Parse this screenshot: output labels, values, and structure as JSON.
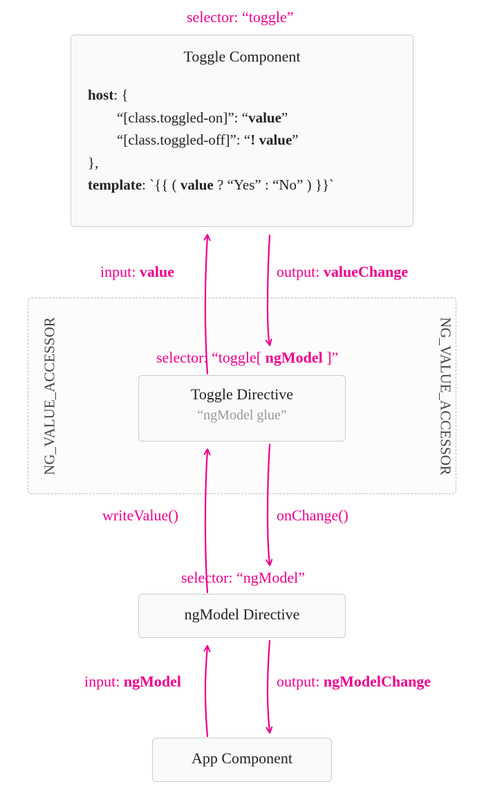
{
  "selectors": {
    "toggle": "selector: “toggle”",
    "toggleNgModel_pre": "selector: “toggle[ ",
    "toggleNgModel_bold": "ngModel",
    "toggleNgModel_post": " ]”",
    "ngModel": "selector: “ngModel”"
  },
  "boxes": {
    "toggleComponent": {
      "title": "Toggle Component",
      "hostLabel": "host",
      "hostOpen": ": {",
      "line1_pre": "“[class.toggled-on]”: “",
      "line1_bold": "value",
      "line1_post": "”",
      "line2_pre": "“[class.toggled-off]”: “",
      "line2_bold": "! value",
      "line2_post": "”",
      "hostClose": "},",
      "templateLabel": "template",
      "templateRest_pre": ": `{{ ( ",
      "templateRest_bold": "value",
      "templateRest_post": " ? “Yes” : “No” ) }}`"
    },
    "toggleDirective": {
      "title": "Toggle Directive",
      "subtitle": "“ngModel glue”"
    },
    "ngModelDirective": {
      "title": "ngModel Directive"
    },
    "appComponent": {
      "title": "App Component"
    }
  },
  "arrows": {
    "inputValue_pre": "input: ",
    "inputValue_bold": "value",
    "outputValueChange_pre": "output: ",
    "outputValueChange_bold": "valueChange",
    "writeValue": "writeValue()",
    "onChange": "onChange()",
    "inputNgModel_pre": "input: ",
    "inputNgModel_bold": "ngModel",
    "outputNgModelChange_pre": "output: ",
    "outputNgModelChange_bold": "ngModelChange"
  },
  "sideLabels": {
    "left": "NG_VALUE_ACCESSOR",
    "right": "NG_VALUE_ACCESSOR"
  }
}
